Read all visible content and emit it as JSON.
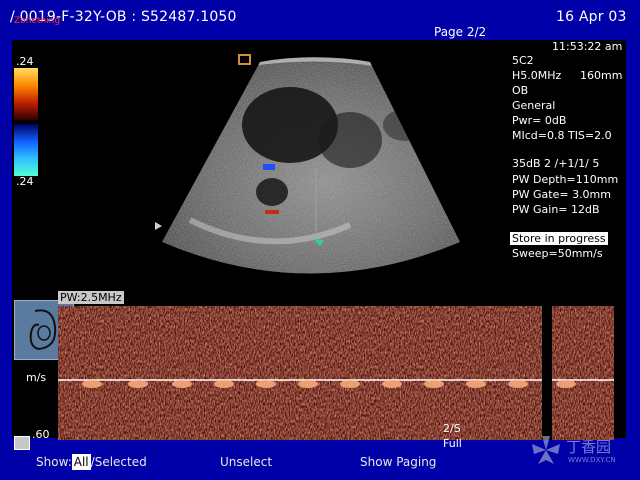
{
  "header": {
    "title": "/ 0019-F-32Y-OB : S52487.1050",
    "date": "16 Apr 03",
    "page": "Page 2/2",
    "time": "11:53:22 am",
    "tag": "Zonething"
  },
  "color_bar": {
    "top_value": ".24",
    "bottom_value": ".24"
  },
  "parameters": {
    "probe": "5C2",
    "freq": "H5.0MHz",
    "depth": "160mm",
    "exam": "OB",
    "preset": "General",
    "pwr": "Pwr=   0dB",
    "mi_tis": "MIcd=0.8   TIS=2.0",
    "db_line": "35dB  2  /+1/1/ 5",
    "pw_depth": "PW Depth=110mm",
    "pw_gate": "PW Gate=  3.0mm",
    "pw_gain": "PW Gain=  12dB",
    "status": "Store in progress",
    "sweep": "Sweep=50mm/s"
  },
  "doppler": {
    "pw_label": "PW:2.5MHz",
    "unit": "m/s",
    "scale_bottom": ".60",
    "speed": "2/S",
    "mode": "Full"
  },
  "footer": {
    "show_prefix": "Show:",
    "show_key": "All",
    "show_selected": "/Selected",
    "unselect": "Unselect",
    "show_paging": "Show Paging",
    "watermark": "丁香园",
    "watermark_url": "WWW.DXY.CN"
  },
  "colors": {
    "background": "#0000a8",
    "doppler_red": "#5a1208",
    "doppler_peak": "#ffb080"
  }
}
